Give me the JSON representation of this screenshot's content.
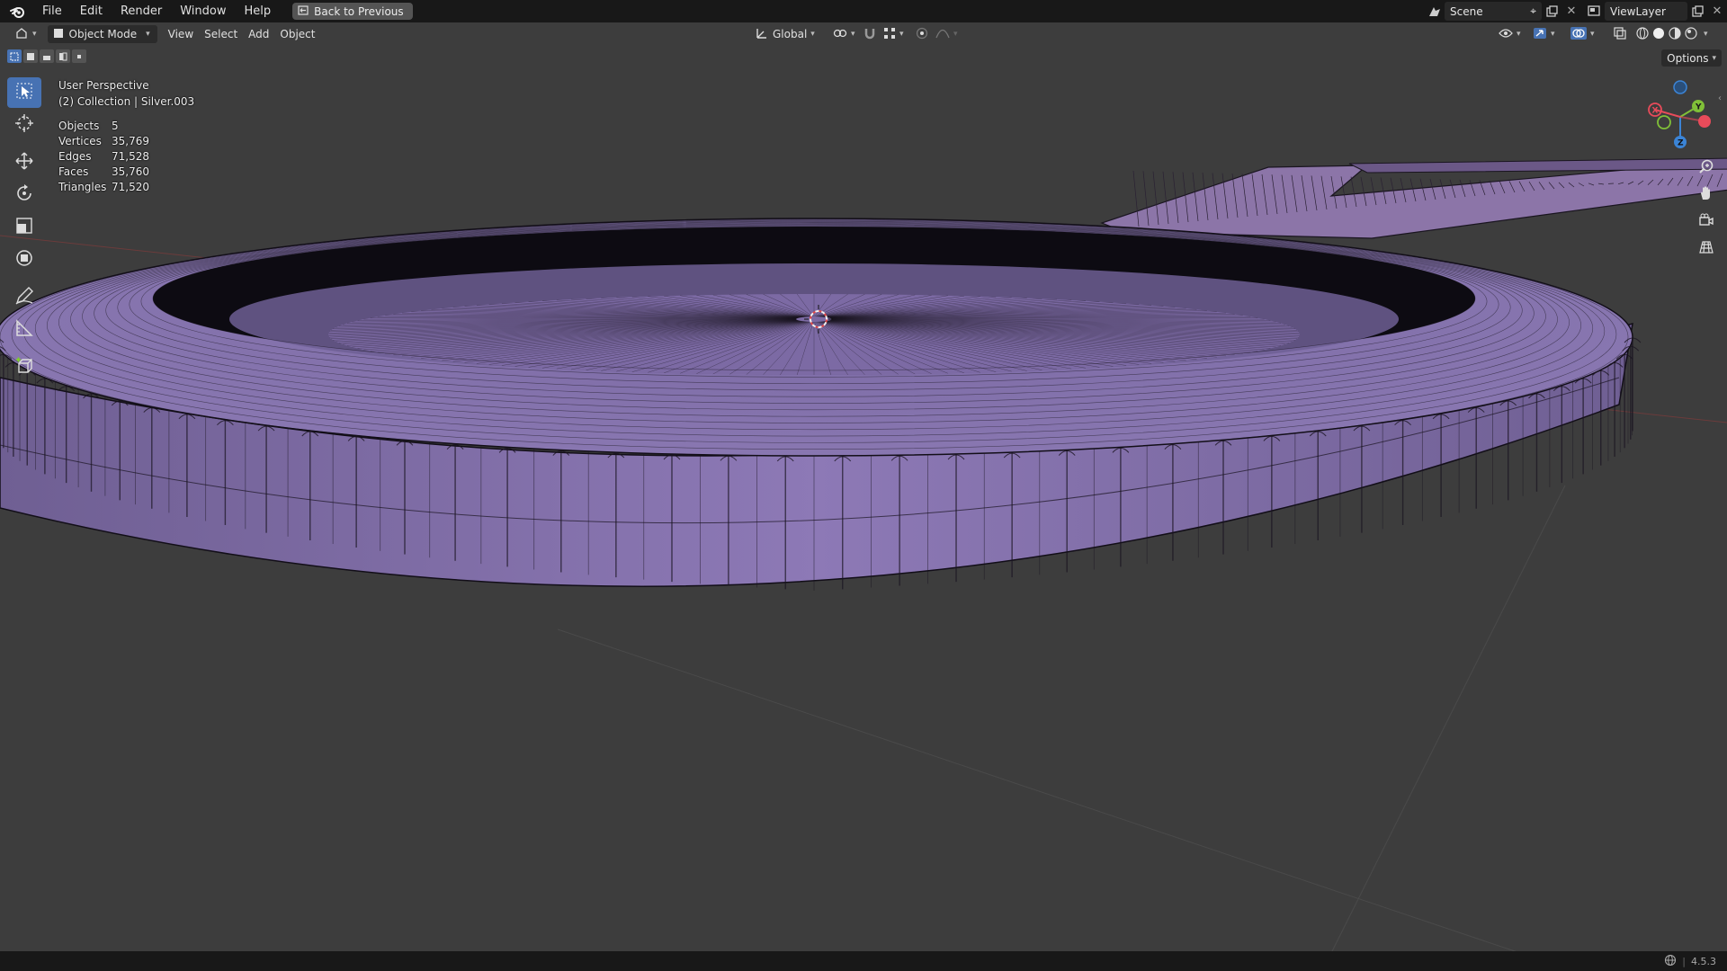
{
  "menu": {
    "items": [
      "File",
      "Edit",
      "Render",
      "Window",
      "Help"
    ],
    "back_button": "Back to Previous"
  },
  "scene": {
    "scene_name": "Scene",
    "view_layer": "ViewLayer"
  },
  "header": {
    "mode": "Object Mode",
    "view": "View",
    "select": "Select",
    "add": "Add",
    "object": "Object",
    "transform_orientation": "Global",
    "options": "Options"
  },
  "overlay": {
    "perspective": "User Perspective",
    "collection": "(2) Collection | Silver.003",
    "stats": [
      {
        "label": "Objects",
        "value": "5"
      },
      {
        "label": "Vertices",
        "value": "35,769"
      },
      {
        "label": "Edges",
        "value": "71,528"
      },
      {
        "label": "Faces",
        "value": "35,760"
      },
      {
        "label": "Triangles",
        "value": "71,520"
      }
    ]
  },
  "status": {
    "version": "4.5.3"
  },
  "colors": {
    "mesh_fill": "#8a76b3",
    "mesh_wire": "#0e0b14",
    "active_tool": "#4772b3",
    "x_axis": "#e84b5a",
    "y_axis": "#80c038",
    "z_axis": "#3b84d6"
  }
}
